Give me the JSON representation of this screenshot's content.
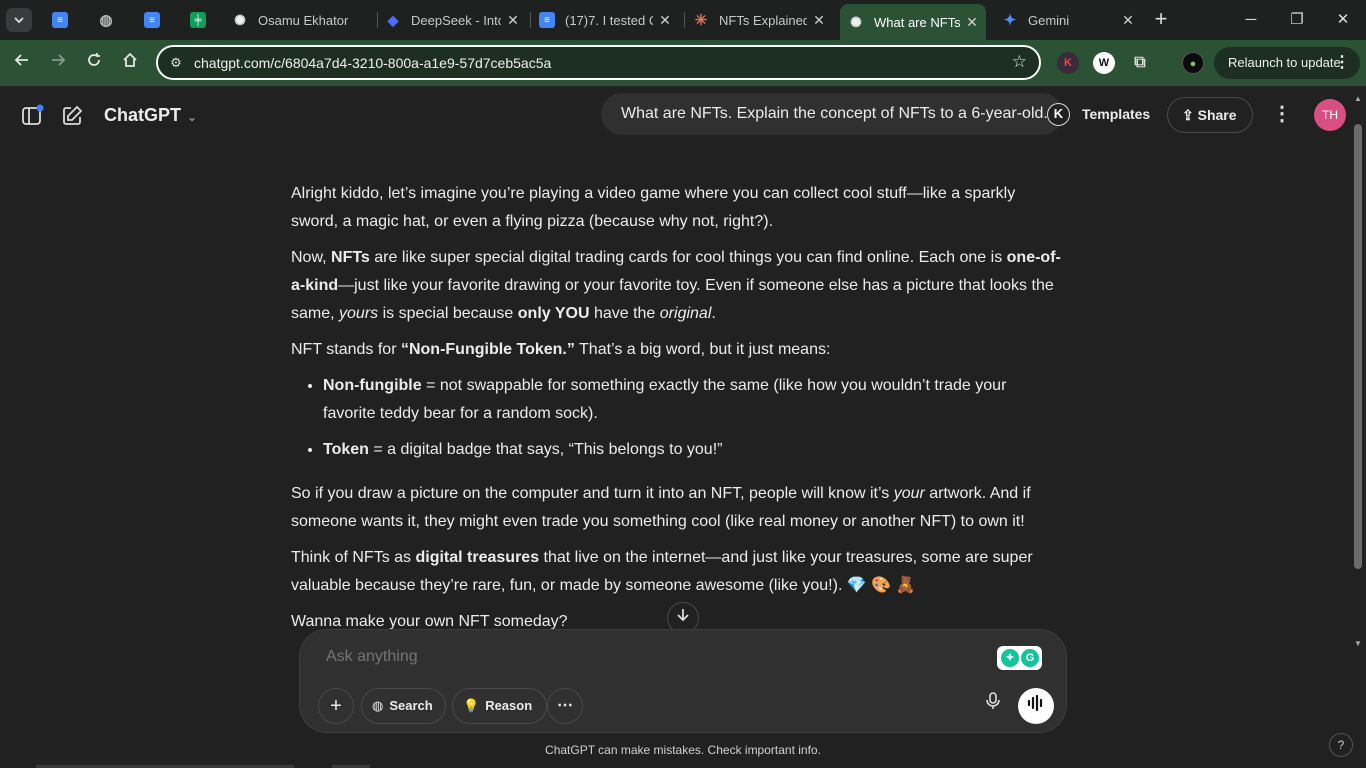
{
  "browser": {
    "tabs": [
      {
        "title": "",
        "icon": "google-docs-icon",
        "color": "#4285f4"
      },
      {
        "title": "",
        "icon": "globe-icon",
        "color": "#9aa0a6"
      },
      {
        "title": "",
        "icon": "google-docs-icon",
        "color": "#4285f4"
      },
      {
        "title": "",
        "icon": "google-sheets-icon",
        "color": "#0f9d58"
      },
      {
        "title": "Osamu Ekhator",
        "icon": "chatgpt-icon",
        "color": "#ececec"
      },
      {
        "title": "DeepSeek - Into",
        "icon": "deepseek-icon",
        "color": "#4d6bfe"
      },
      {
        "title": "(17)7. I tested C",
        "icon": "google-docs-icon",
        "color": "#4285f4"
      },
      {
        "title": "NFTs Explained",
        "icon": "claude-icon",
        "color": "#d97757"
      },
      {
        "title": "What are NFTs",
        "icon": "chatgpt-icon",
        "color": "#ececec",
        "active": true
      },
      {
        "title": "Gemini",
        "icon": "gemini-icon",
        "color": "#4e8cff"
      }
    ],
    "url": "chatgpt.com/c/6804a7d4-3210-800a-a1e9-57d7ceb5ac5a",
    "relaunch_label": "Relaunch to update"
  },
  "header": {
    "brand": "ChatGPT",
    "pinned_question": "What are NFTs. Explain the concept of NFTs to a 6-year-old.",
    "k_avatar": "K",
    "templates": "Templates",
    "share": "Share",
    "avatar_initials": "TH"
  },
  "message": {
    "p1": "Alright kiddo, let’s imagine you’re playing a video game where you can collect cool stuff—like a sparkly sword, a magic hat, or even a flying pizza (because why not, right?).",
    "p2": {
      "a": "Now, ",
      "b": "NFTs",
      "c": " are like super special digital trading cards for cool things you can find online. Each one is ",
      "d": "one-of-a-kind",
      "e": "—just like your favorite drawing or your favorite toy. Even if someone else has a picture that looks the same, ",
      "f": "yours",
      "g": " is special because ",
      "h": "only YOU",
      "i": " have the ",
      "j": "original",
      "k": "."
    },
    "p3": {
      "a": "NFT stands for ",
      "b": "“Non-Fungible Token.”",
      "c": " That’s a big word, but it just means:"
    },
    "bullets": [
      {
        "term": "Non-fungible",
        "text": " = not swappable for something exactly the same (like how you wouldn’t trade your favorite teddy bear for a random sock)."
      },
      {
        "term": "Token",
        "text": " = a digital badge that says, “This belongs to you!”"
      }
    ],
    "p4": {
      "a": "So if you draw a picture on the computer and turn it into an NFT, people will know it’s ",
      "b": "your",
      "c": " artwork. And if someone wants it, they might even trade you something cool (like real money or another NFT) to own it!"
    },
    "p5": {
      "a": "Think of NFTs as ",
      "b": "digital treasures",
      "c": " that live on the internet—and just like your treasures, some are super valuable because they’re rare, fun, or made by someone awesome (like you!). 💎 🎨 🧸"
    },
    "p6": "Wanna make your own NFT someday?"
  },
  "composer": {
    "placeholder": "Ask anything",
    "search_label": "Search",
    "reason_label": "Reason"
  },
  "footer": {
    "disclaimer": "ChatGPT can make mistakes. Check important info.",
    "help": "?"
  }
}
